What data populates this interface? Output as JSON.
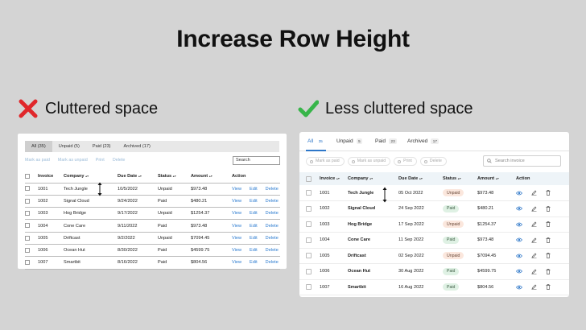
{
  "title": "Increase Row Height",
  "left": {
    "heading": "Cluttered space",
    "tabs": [
      "All (35)",
      "Unpaid (5)",
      "Paid (23)",
      "Archived (17)"
    ],
    "actions": [
      "Mark as paid",
      "Mark as unpaid",
      "Print",
      "Delete"
    ],
    "search": "Search",
    "columns": [
      "Invoice",
      "Company",
      "Due Date",
      "Status",
      "Amount",
      "Action"
    ],
    "links": {
      "view": "View",
      "edit": "Edit",
      "delete": "Delete"
    },
    "rows": [
      {
        "invoice": "1001",
        "company": "Tech Jungle",
        "date": "10/5/2022",
        "status": "Unpaid",
        "amount": "$973.48"
      },
      {
        "invoice": "1002",
        "company": "Signal Cloud",
        "date": "9/24/2022",
        "status": "Paid",
        "amount": "$480.21"
      },
      {
        "invoice": "1003",
        "company": "Hog Bridge",
        "date": "9/17/2022",
        "status": "Unpaid",
        "amount": "$1254.37"
      },
      {
        "invoice": "1004",
        "company": "Cone Care",
        "date": "9/11/2022",
        "status": "Paid",
        "amount": "$973.48"
      },
      {
        "invoice": "1005",
        "company": "Driftcast",
        "date": "9/2/2022",
        "status": "Unpaid",
        "amount": "$7094.45"
      },
      {
        "invoice": "1006",
        "company": "Ocean Hut",
        "date": "8/30/2022",
        "status": "Paid",
        "amount": "$4599.75"
      },
      {
        "invoice": "1007",
        "company": "Smartbit",
        "date": "8/16/2022",
        "status": "Paid",
        "amount": "$804.56"
      }
    ]
  },
  "right": {
    "heading": "Less cluttered space",
    "tabs": [
      {
        "label": "All",
        "count": "35"
      },
      {
        "label": "Unpaid",
        "count": "5"
      },
      {
        "label": "Paid",
        "count": "23"
      },
      {
        "label": "Archived",
        "count": "17"
      }
    ],
    "actions": [
      "Mark as paid",
      "Mark as unpaid",
      "Print",
      "Delete"
    ],
    "search_placeholder": "Search invoice",
    "columns": [
      "Invoice",
      "Company",
      "Due Date",
      "Status",
      "Amount",
      "Action"
    ],
    "rows": [
      {
        "invoice": "1001",
        "company": "Tech Jungle",
        "date": "05 Oct 2022",
        "status": "Unpaid",
        "amount": "$973.48"
      },
      {
        "invoice": "1002",
        "company": "Signal Cloud",
        "date": "24 Sep 2022",
        "status": "Paid",
        "amount": "$480.21"
      },
      {
        "invoice": "1003",
        "company": "Hog Bridge",
        "date": "17 Sep 2022",
        "status": "Unpaid",
        "amount": "$1254.37"
      },
      {
        "invoice": "1004",
        "company": "Cone Care",
        "date": "11 Sep 2022",
        "status": "Paid",
        "amount": "$973.48"
      },
      {
        "invoice": "1005",
        "company": "Driftcast",
        "date": "02 Sep 2022",
        "status": "Unpaid",
        "amount": "$7094.45"
      },
      {
        "invoice": "1006",
        "company": "Ocean Hut",
        "date": "30 Aug 2022",
        "status": "Paid",
        "amount": "$4599.75"
      },
      {
        "invoice": "1007",
        "company": "Smartbit",
        "date": "16 Aug 2022",
        "status": "Paid",
        "amount": "$804.56"
      }
    ]
  },
  "colors": {
    "bad": "#e0272b",
    "good": "#38b54a",
    "link": "#2b7bd0",
    "accent": "#2e77c9"
  },
  "icons": {
    "bad_mark": "cross-icon",
    "good_mark": "check-icon",
    "row_height": "double-arrow-icon",
    "view": "eye-icon",
    "edit": "pencil-icon",
    "delete": "trash-icon"
  }
}
